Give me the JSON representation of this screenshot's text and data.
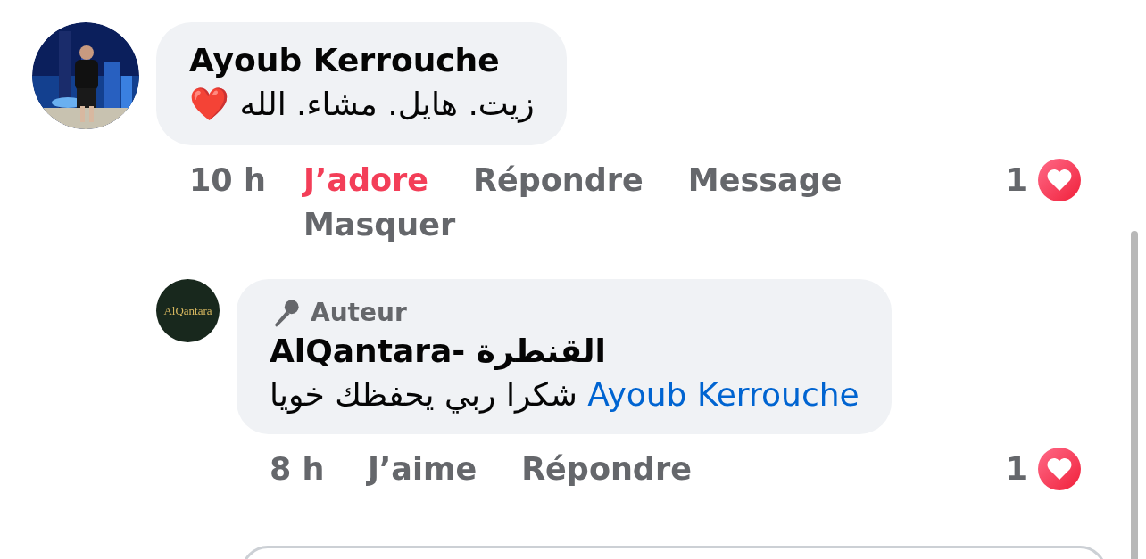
{
  "comments": [
    {
      "author": "Ayoub Kerrouche",
      "avatar": {
        "kind": "picture"
      },
      "text": "زيت. هايل. مشاء. الله ❤️",
      "time": "10 h",
      "actions": [
        {
          "label": "J’adore",
          "liked": true
        },
        {
          "label": "Répondre"
        },
        {
          "label": "Message"
        },
        {
          "label": "Masquer"
        }
      ],
      "reaction_count": "1",
      "replies": [
        {
          "author": "AlQantara- القنطرة",
          "avatar": {
            "kind": "logo",
            "text": "AlQantara"
          },
          "badge": "Auteur",
          "mention": "Ayoub Kerrouche",
          "text": "شكرا ربي يحفظك خويا",
          "time": "8 h",
          "actions": [
            {
              "label": "J’aime",
              "liked": false
            },
            {
              "label": "Répondre"
            }
          ],
          "reaction_count": "1"
        }
      ]
    }
  ]
}
